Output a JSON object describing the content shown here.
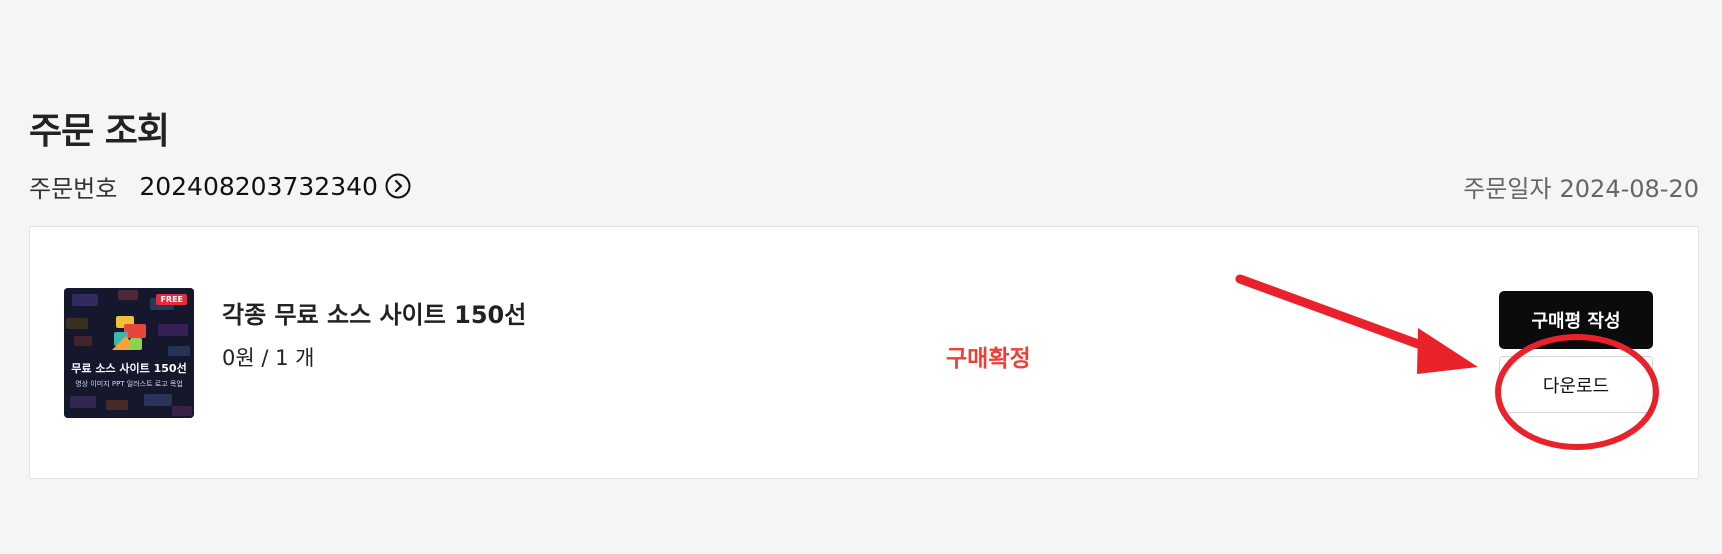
{
  "page": {
    "title": "주문 조회"
  },
  "order": {
    "number_label": "주문번호",
    "number": "202408203732340",
    "date_label": "주문일자",
    "date": "2024-08-20"
  },
  "item": {
    "thumbnail": {
      "badge": "FREE",
      "title": "무료 소스 사이트 150선",
      "subtitle": "영상 이미지 PPT 일러스트 로고 목업"
    },
    "name": "각종 무료 소스 사이트 150선",
    "price_quantity": "0원 / 1 개",
    "status": "구매확정",
    "status_color": "#ee3f35"
  },
  "actions": {
    "review_label": "구매평 작성",
    "download_label": "다운로드"
  },
  "annotation": {
    "color": "#e8212b",
    "arrow_icon": "red-arrow",
    "circle_icon": "red-circle"
  },
  "icons": {
    "order_link": "chevron-right-circle-icon"
  }
}
